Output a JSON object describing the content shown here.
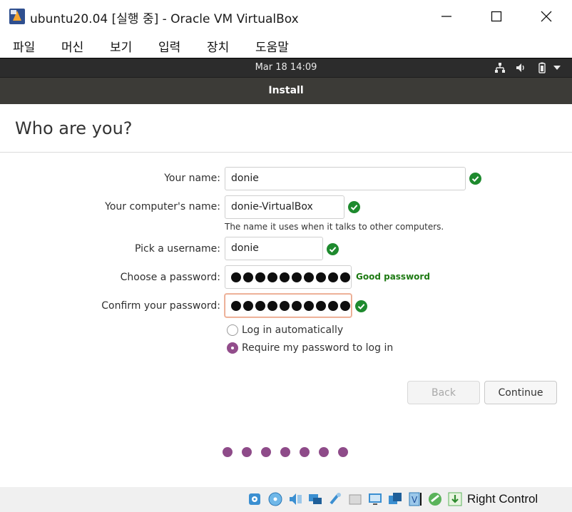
{
  "window": {
    "title": "ubuntu20.04 [실행 중] - Oracle VM VirtualBox",
    "menu": [
      "파일",
      "머신",
      "보기",
      "입력",
      "장치",
      "도움말"
    ]
  },
  "guest_topbar": {
    "clock": "Mar 18  14:09",
    "tray_icons": [
      "network-icon",
      "volume-icon",
      "battery-icon",
      "dropdown-arrow-icon"
    ]
  },
  "installer": {
    "header_title": "Install",
    "page_title": "Who are you?",
    "fields": {
      "name": {
        "label": "Your name:",
        "value": "donie",
        "valid": true
      },
      "computer": {
        "label": "Your computer's name:",
        "value": "donie-VirtualBox",
        "hint": "The name it uses when it talks to other computers.",
        "valid": true
      },
      "username": {
        "label": "Pick a username:",
        "value": "donie",
        "valid": true
      },
      "password": {
        "label": "Choose a password:",
        "masked_length": 12,
        "strength": "Good password"
      },
      "confirm": {
        "label": "Confirm your password:",
        "masked_length": 12,
        "valid": true
      }
    },
    "login_options": [
      {
        "label": "Log in automatically",
        "selected": false
      },
      {
        "label": "Require my password to log in",
        "selected": true
      }
    ],
    "buttons": {
      "back": "Back",
      "continue": "Continue"
    },
    "progress": {
      "total_steps": 7
    }
  },
  "statusbar": {
    "host_key": "Right Control"
  },
  "colors": {
    "accent": "#924d8b",
    "valid_green": "#1e8a2e",
    "strength_green": "#1e7a13",
    "header_bg": "#3c3b37",
    "topbar_bg": "#2c2c2c"
  }
}
